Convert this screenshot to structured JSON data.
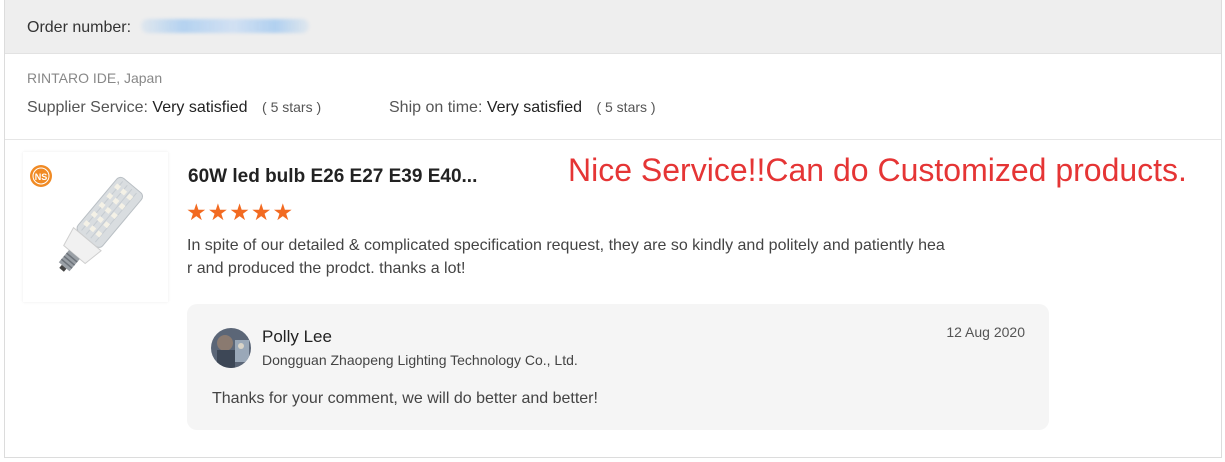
{
  "order": {
    "label": "Order number:"
  },
  "reviewer": {
    "name_location": "RINTARO IDE, Japan"
  },
  "ratings": [
    {
      "label": "Supplier Service:",
      "value": "Very satisfied",
      "stars": "( 5 stars )"
    },
    {
      "label": "Ship on time:",
      "value": "Very satisfied",
      "stars": "( 5 stars )"
    }
  ],
  "product": {
    "title": "60W led bulb E26 E27 E39 E40...",
    "star_rating": 5,
    "stars_display": "★★★★★",
    "brand_badge": "NS",
    "star_color": "#f26a21"
  },
  "annotation": {
    "text": "Nice Service!!Can do Customized products.",
    "color": "#e53535"
  },
  "comment": {
    "line1": "In spite of our detailed & complicated specification request, they are so kindly and politely and patiently hea",
    "line2": "r and produced the prodct. thanks a lot!"
  },
  "reply": {
    "name": "Polly Lee",
    "company": "Dongguan Zhaopeng Lighting Technology Co., Ltd.",
    "date": "12 Aug 2020",
    "text": "Thanks for your comment, we will do better and better!"
  }
}
